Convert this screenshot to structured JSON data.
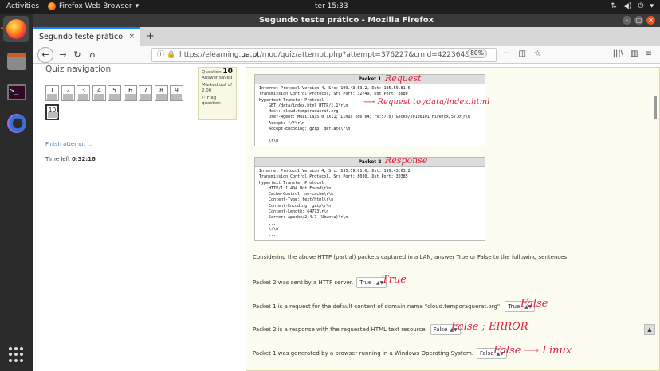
{
  "topbar": {
    "activities": "Activities",
    "app": "Firefox Web Browser",
    "clock": "ter 15:33"
  },
  "window": {
    "title": "Segundo teste prático - Mozilla Firefox"
  },
  "tab": {
    "label": "Segundo teste prático",
    "close": "×"
  },
  "newtab": "+",
  "url": {
    "prefix": "https://elearning.",
    "host": "ua.pt",
    "path": "/mod/quiz/attempt.php?attempt=376227&cmid=422364&pa",
    "zoom": "80%"
  },
  "quiznav": {
    "title": "Quiz navigation",
    "buttons": [
      "1",
      "2",
      "3",
      "4",
      "5",
      "6",
      "7",
      "8",
      "9",
      "10"
    ],
    "finish": "Finish attempt ...",
    "time_label": "Time left",
    "time_value": "0:32:16"
  },
  "qinfo": {
    "label": "Question",
    "number": "10",
    "status": "Answer saved",
    "marked": "Marked out of 2.00",
    "flag": "Flag question"
  },
  "packet1": {
    "header": "Packet 1",
    "lines": "Internet Protocol Version 4, Src: 199.43.63.2, Dst: 195.59.81.6\nTransmission Control Protocol, Src Port: 32749, Dst Port: 8080\nHypertext Transfer Protocol\n    GET /data/index.html HTTP/1.1\\r\\n\n    Host: cloud.temporaquerat.org\n    User-Agent: Mozilla/5.0 (X11; Linux x86_64; rv:57.0) Gecko/20100101 Firefox/57.0\\r\\n\n    Accept: */*\\r\\n\n    Accept-Encoding: gzip, deflate\\r\\n\n    ...\n    \\r\\n"
  },
  "packet2": {
    "header": "Packet 2",
    "lines": "Internet Protocol Version 4, Src: 195.59.81.6, Dst: 199.43.63.2\nTransmission Control Protocol, Src Port: 8080, Dst Port: 30385\nHypertext Transfer Protocol\n    HTTP/1.1 404 Not Found\\r\\n\n    Cache-Control: no-cache\\r\\n\n    Content-Type: text/html\\r\\n\n    Content-Encoding: gzip\\r\\n\n    Content-Length: 64773\\r\\n\n    Server: Apache/2.4.7 (Ubuntu)\\r\\n\n    ...\n    \\r\\n\n    ..."
  },
  "question": {
    "intro": "Considering the above HTTP (partial) packets captured in a LAN, answer True or False to the following sentences:",
    "items": [
      {
        "text": "Packet 2 was sent by a HTTP server.",
        "answer": "True"
      },
      {
        "text": "Packet 1 is a request for the default content of domain name \"cloud.temporaquerat.org\".",
        "answer": "True"
      },
      {
        "text": "Packet 2 is a response with the requested HTML text resource.",
        "answer": "False"
      },
      {
        "text": "Packet 1 was generated by a browser running in a Windows Operating System.",
        "answer": "False"
      }
    ]
  },
  "notes": {
    "request": "Request",
    "request_to": "⟶ Request to /data/index.html",
    "response": "Response",
    "a1": "True",
    "a2": "False",
    "a3": "False ; ERROR",
    "a4": "False ⟶ Linux"
  },
  "colors": {
    "accent": "#e95420",
    "annotation": "#e0203c",
    "link": "#3a7bbf"
  }
}
